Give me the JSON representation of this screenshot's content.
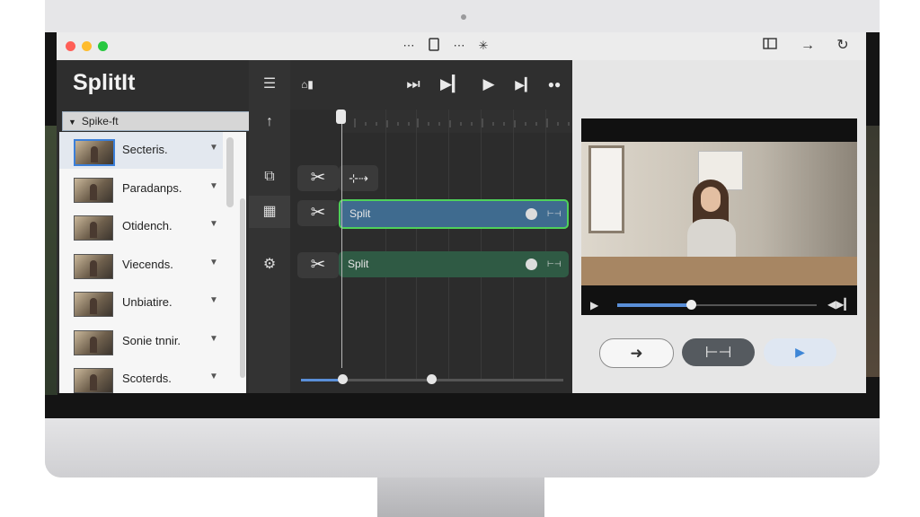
{
  "app": {
    "title": "SplitIt"
  },
  "titlebar": {
    "icons": [
      "more-icon",
      "document-icon",
      "more-icon",
      "sparkle-icon",
      "sidebar-icon",
      "arrow-right-icon",
      "refresh-icon"
    ]
  },
  "file_list": {
    "header": "Spike-ft",
    "items": [
      {
        "label": "Secteris."
      },
      {
        "label": "Paradanps."
      },
      {
        "label": "Otidench."
      },
      {
        "label": "Viecends."
      },
      {
        "label": "Unbiatire."
      },
      {
        "label": "Sonie tnnir."
      },
      {
        "label": "Scoterds."
      }
    ]
  },
  "timeline": {
    "tracks": [
      {
        "label": "Split",
        "color": "#3f6b8f",
        "border": "#4fd15a"
      },
      {
        "label": "Split",
        "color": "#2f5a44",
        "border": "#2f5a44"
      }
    ],
    "zoom": {
      "start": 0.16,
      "end": 0.5
    }
  },
  "preview": {
    "progress": 0.37
  },
  "colors": {
    "accent": "#5a8fd8",
    "selected_outline": "#4fd15a"
  }
}
